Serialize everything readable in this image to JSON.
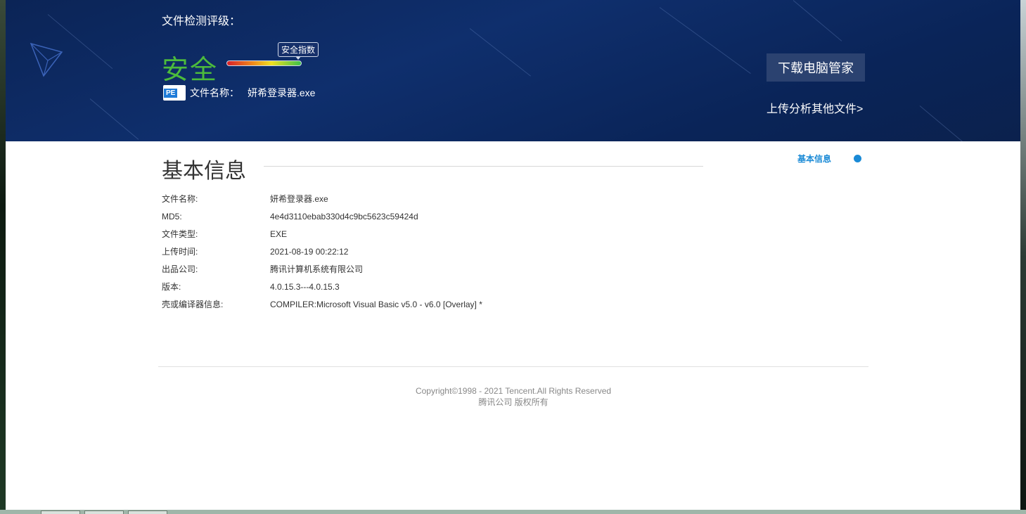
{
  "hero": {
    "verdict_label": "文件检测评级：",
    "verdict": "安全",
    "meter_label": "安全指数",
    "file_icon": "PE",
    "file_label": "文件名称：",
    "file_name": "妍希登录器.exe",
    "download_button": "下载电脑管家",
    "upload_link": "上传分析其他文件>"
  },
  "section": {
    "title": "基本信息",
    "side_nav": "基本信息"
  },
  "info": [
    {
      "key": "文件名称:",
      "value": "妍希登录器.exe"
    },
    {
      "key": "MD5:",
      "value": "4e4d3110ebab330d4c9bc5623c59424d"
    },
    {
      "key": "文件类型:",
      "value": "EXE"
    },
    {
      "key": "上传时间:",
      "value": "2021-08-19 00:22:12"
    },
    {
      "key": "出品公司:",
      "value": "腾讯计算机系统有限公司"
    },
    {
      "key": "版本:",
      "value": "4.0.15.3---4.0.15.3"
    },
    {
      "key": "壳或编译器信息:",
      "value": "COMPILER:Microsoft Visual Basic v5.0 - v6.0 [Overlay] *"
    }
  ],
  "footer": {
    "copyright": "Copyright©1998 - 2021 Tencent.All Rights Reserved",
    "cn": "腾讯公司 版权所有"
  },
  "colors": {
    "hero_bg": "#0f2f6d",
    "safe_green": "#4cbb3c",
    "accent_blue": "#1a8ad6"
  }
}
